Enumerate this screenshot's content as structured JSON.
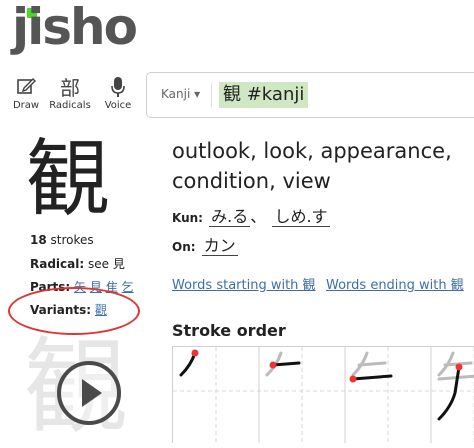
{
  "logo": {
    "text": "jisho"
  },
  "toolbar": {
    "draw_label": "Draw",
    "radicals_label": "Radicals",
    "radicals_glyph": "部",
    "voice_label": "Voice"
  },
  "search": {
    "selector": "Kanji ▾",
    "query": "観 #kanji"
  },
  "kanji": {
    "character": "観",
    "strokes_count": "18",
    "strokes_word": "strokes",
    "radical_label": "Radical:",
    "radical_value": "see 見",
    "parts_label": "Parts:",
    "parts": [
      "矢",
      "見",
      "隹",
      "乞"
    ],
    "variants_label": "Variants:",
    "variants": [
      "觀"
    ]
  },
  "meanings": "outlook, look, appearance, condition, view",
  "readings": {
    "kun_label": "Kun:",
    "kun": [
      "み.る",
      "しめ.す"
    ],
    "kun_sep": "、",
    "on_label": "On:",
    "on": [
      "カン"
    ]
  },
  "links": {
    "starting": "Words starting with 観",
    "ending": "Words ending with 観"
  },
  "stroke_order": {
    "title": "Stroke order"
  },
  "ghost_char": "観",
  "colors": {
    "logo_green": "#47db27",
    "highlight": "#cfe8c3",
    "link": "#3c6ea8",
    "annotation": "#e03434"
  }
}
